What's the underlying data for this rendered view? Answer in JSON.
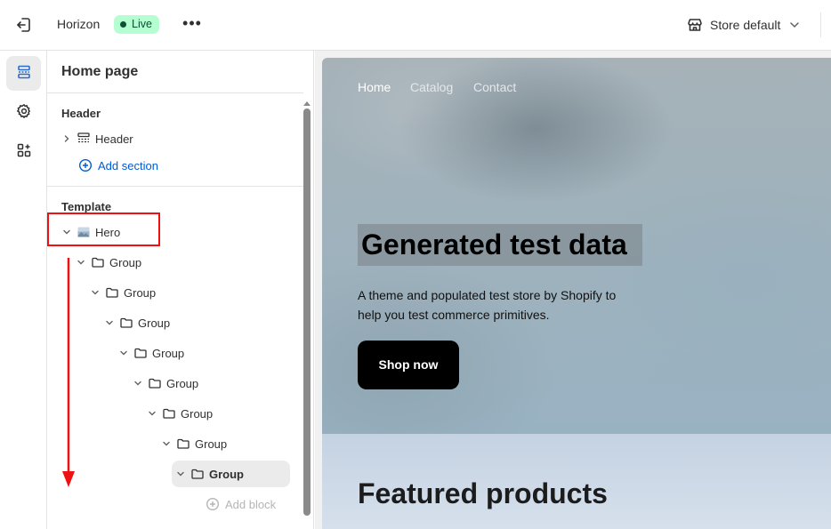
{
  "topbar": {
    "theme_name": "Horizon",
    "status_badge": "Live",
    "more_label": "•••",
    "store_label": "Store default",
    "icons": {
      "exit": "exit-icon",
      "store": "store-icon",
      "chevron": "chevron-down-icon"
    }
  },
  "rail": {
    "items": [
      {
        "name": "sections",
        "icon": "sections-icon",
        "active": true
      },
      {
        "name": "settings",
        "icon": "gear-icon",
        "active": false
      },
      {
        "name": "apps",
        "icon": "apps-icon",
        "active": false
      }
    ]
  },
  "sidebar": {
    "title": "Home page",
    "header_group": {
      "heading": "Header",
      "items": [
        {
          "label": "Header",
          "icon": "header-layout-icon"
        }
      ],
      "add_section": "Add section"
    },
    "template_group": {
      "heading": "Template",
      "hero": {
        "label": "Hero",
        "icon": "image-icon"
      },
      "groups": [
        "Group",
        "Group",
        "Group",
        "Group",
        "Group",
        "Group",
        "Group",
        "Group"
      ],
      "add_block": "Add block"
    }
  },
  "annotations": {
    "highlight_color": "#ee1111",
    "arrow_color": "#ee1111"
  },
  "preview": {
    "nav": [
      "Home",
      "Catalog",
      "Contact"
    ],
    "hero_title": "Generated test data",
    "hero_subtitle": "A theme and populated test store by Shopify to help you test commerce primitives.",
    "cta": "Shop now",
    "featured_title": "Featured products"
  },
  "colors": {
    "live_badge_bg": "#b4fed2",
    "link_blue": "#005bd3",
    "selected_row_bg": "#ebebeb",
    "cta_bg": "#000000"
  }
}
